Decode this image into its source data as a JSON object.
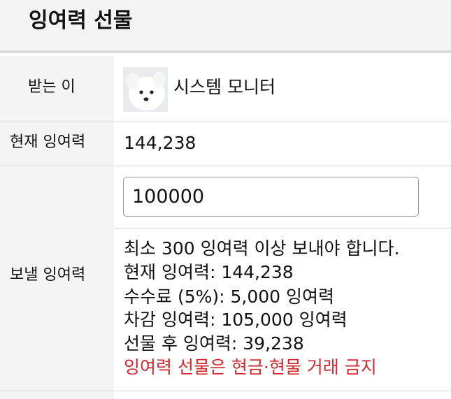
{
  "header": {
    "title": "잉여력 선물"
  },
  "recipient": {
    "label": "받는 이",
    "name": "시스템 모니터"
  },
  "current_surplus": {
    "label": "현재 잉여력",
    "value": "144,238"
  },
  "send": {
    "label": "보낼 잉여력",
    "input_value": "100000"
  },
  "info": {
    "minimum_notice": "최소 300 잉여력 이상 보내야 합니다.",
    "current_surplus_line": "현재 잉여력: 144,238",
    "fee_line": "수수료 (5%): 5,000 잉여력",
    "deducted_line": "차감 잉여력: 105,000 잉여력",
    "after_gift_line": "선물 후 잉여력: 39,238",
    "prohibition_notice": "잉여력 선물은 현금·현물 거래 금지"
  },
  "colors": {
    "header_bg": "#f4f4f4",
    "label_bg": "#f4f4f4",
    "warning": "#d0282e",
    "divider": "#d8d8d8"
  },
  "icons": {
    "recipient_avatar": "white-dog-avatar"
  }
}
